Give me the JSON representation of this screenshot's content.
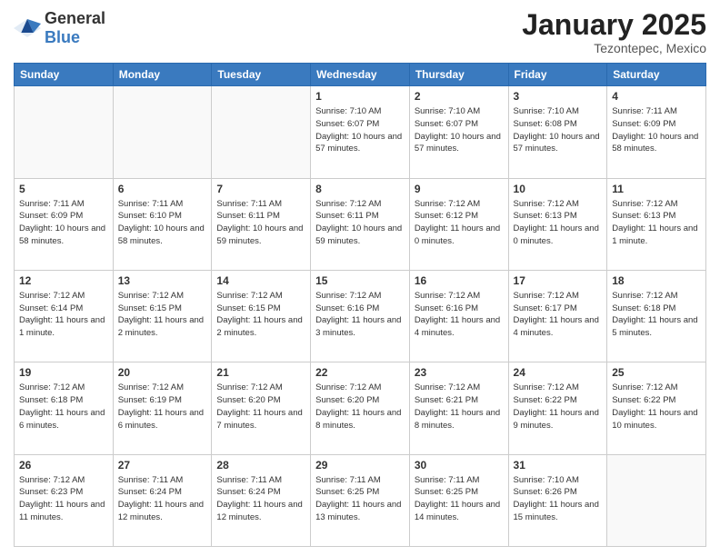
{
  "logo": {
    "general": "General",
    "blue": "Blue"
  },
  "title": "January 2025",
  "location": "Tezontepec, Mexico",
  "days_of_week": [
    "Sunday",
    "Monday",
    "Tuesday",
    "Wednesday",
    "Thursday",
    "Friday",
    "Saturday"
  ],
  "weeks": [
    [
      {
        "day": "",
        "info": ""
      },
      {
        "day": "",
        "info": ""
      },
      {
        "day": "",
        "info": ""
      },
      {
        "day": "1",
        "sunrise": "7:10 AM",
        "sunset": "6:07 PM",
        "daylight": "10 hours and 57 minutes."
      },
      {
        "day": "2",
        "sunrise": "7:10 AM",
        "sunset": "6:07 PM",
        "daylight": "10 hours and 57 minutes."
      },
      {
        "day": "3",
        "sunrise": "7:10 AM",
        "sunset": "6:08 PM",
        "daylight": "10 hours and 57 minutes."
      },
      {
        "day": "4",
        "sunrise": "7:11 AM",
        "sunset": "6:09 PM",
        "daylight": "10 hours and 58 minutes."
      }
    ],
    [
      {
        "day": "5",
        "sunrise": "7:11 AM",
        "sunset": "6:09 PM",
        "daylight": "10 hours and 58 minutes."
      },
      {
        "day": "6",
        "sunrise": "7:11 AM",
        "sunset": "6:10 PM",
        "daylight": "10 hours and 58 minutes."
      },
      {
        "day": "7",
        "sunrise": "7:11 AM",
        "sunset": "6:11 PM",
        "daylight": "10 hours and 59 minutes."
      },
      {
        "day": "8",
        "sunrise": "7:12 AM",
        "sunset": "6:11 PM",
        "daylight": "10 hours and 59 minutes."
      },
      {
        "day": "9",
        "sunrise": "7:12 AM",
        "sunset": "6:12 PM",
        "daylight": "11 hours and 0 minutes."
      },
      {
        "day": "10",
        "sunrise": "7:12 AM",
        "sunset": "6:13 PM",
        "daylight": "11 hours and 0 minutes."
      },
      {
        "day": "11",
        "sunrise": "7:12 AM",
        "sunset": "6:13 PM",
        "daylight": "11 hours and 1 minute."
      }
    ],
    [
      {
        "day": "12",
        "sunrise": "7:12 AM",
        "sunset": "6:14 PM",
        "daylight": "11 hours and 1 minute."
      },
      {
        "day": "13",
        "sunrise": "7:12 AM",
        "sunset": "6:15 PM",
        "daylight": "11 hours and 2 minutes."
      },
      {
        "day": "14",
        "sunrise": "7:12 AM",
        "sunset": "6:15 PM",
        "daylight": "11 hours and 2 minutes."
      },
      {
        "day": "15",
        "sunrise": "7:12 AM",
        "sunset": "6:16 PM",
        "daylight": "11 hours and 3 minutes."
      },
      {
        "day": "16",
        "sunrise": "7:12 AM",
        "sunset": "6:16 PM",
        "daylight": "11 hours and 4 minutes."
      },
      {
        "day": "17",
        "sunrise": "7:12 AM",
        "sunset": "6:17 PM",
        "daylight": "11 hours and 4 minutes."
      },
      {
        "day": "18",
        "sunrise": "7:12 AM",
        "sunset": "6:18 PM",
        "daylight": "11 hours and 5 minutes."
      }
    ],
    [
      {
        "day": "19",
        "sunrise": "7:12 AM",
        "sunset": "6:18 PM",
        "daylight": "11 hours and 6 minutes."
      },
      {
        "day": "20",
        "sunrise": "7:12 AM",
        "sunset": "6:19 PM",
        "daylight": "11 hours and 6 minutes."
      },
      {
        "day": "21",
        "sunrise": "7:12 AM",
        "sunset": "6:20 PM",
        "daylight": "11 hours and 7 minutes."
      },
      {
        "day": "22",
        "sunrise": "7:12 AM",
        "sunset": "6:20 PM",
        "daylight": "11 hours and 8 minutes."
      },
      {
        "day": "23",
        "sunrise": "7:12 AM",
        "sunset": "6:21 PM",
        "daylight": "11 hours and 8 minutes."
      },
      {
        "day": "24",
        "sunrise": "7:12 AM",
        "sunset": "6:22 PM",
        "daylight": "11 hours and 9 minutes."
      },
      {
        "day": "25",
        "sunrise": "7:12 AM",
        "sunset": "6:22 PM",
        "daylight": "11 hours and 10 minutes."
      }
    ],
    [
      {
        "day": "26",
        "sunrise": "7:12 AM",
        "sunset": "6:23 PM",
        "daylight": "11 hours and 11 minutes."
      },
      {
        "day": "27",
        "sunrise": "7:11 AM",
        "sunset": "6:24 PM",
        "daylight": "11 hours and 12 minutes."
      },
      {
        "day": "28",
        "sunrise": "7:11 AM",
        "sunset": "6:24 PM",
        "daylight": "11 hours and 12 minutes."
      },
      {
        "day": "29",
        "sunrise": "7:11 AM",
        "sunset": "6:25 PM",
        "daylight": "11 hours and 13 minutes."
      },
      {
        "day": "30",
        "sunrise": "7:11 AM",
        "sunset": "6:25 PM",
        "daylight": "11 hours and 14 minutes."
      },
      {
        "day": "31",
        "sunrise": "7:10 AM",
        "sunset": "6:26 PM",
        "daylight": "11 hours and 15 minutes."
      },
      {
        "day": "",
        "info": ""
      }
    ]
  ]
}
